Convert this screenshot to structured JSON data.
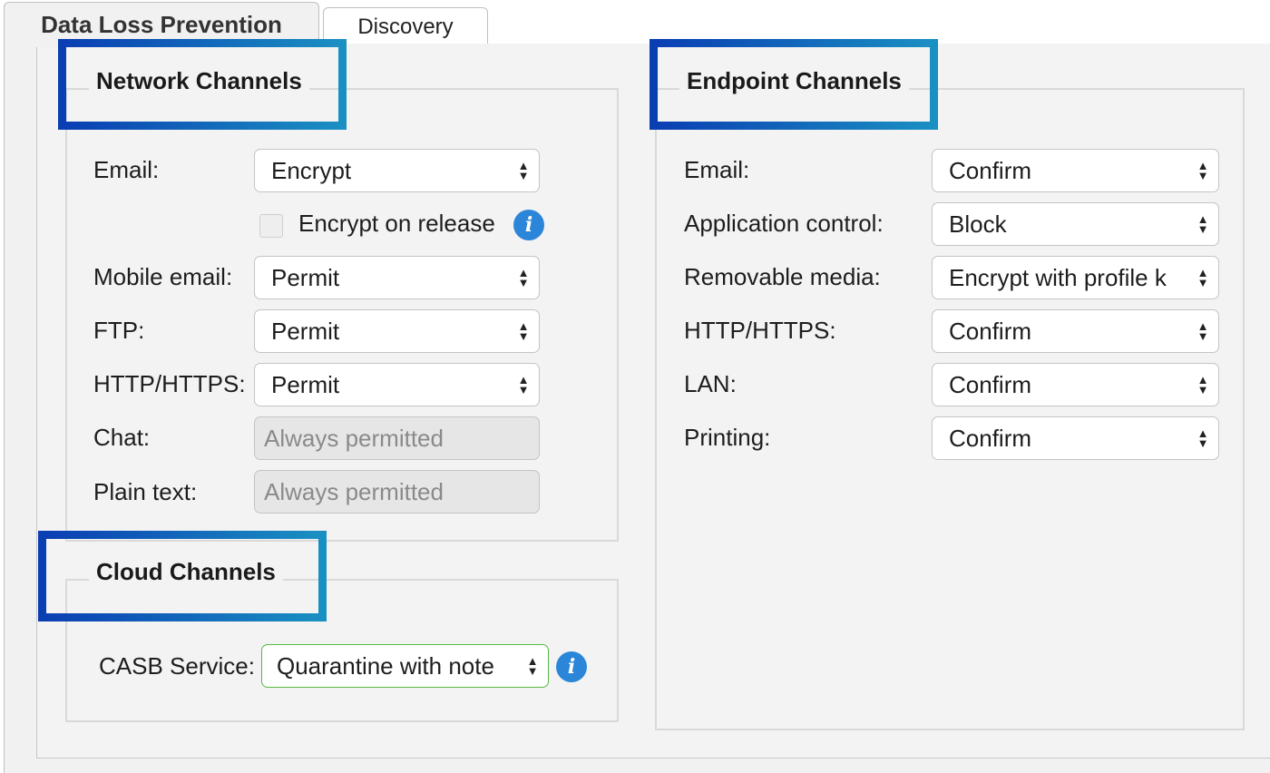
{
  "tabs": [
    {
      "label": "Data Loss Prevention",
      "active": true
    },
    {
      "label": "Discovery",
      "active": false
    }
  ],
  "network": {
    "title": "Network Channels",
    "email": {
      "label": "Email:",
      "value": "Encrypt"
    },
    "encrypt_on_release": {
      "label": "Encrypt on release",
      "checked": false
    },
    "mobile_email": {
      "label": "Mobile email:",
      "value": "Permit"
    },
    "ftp": {
      "label": "FTP:",
      "value": "Permit"
    },
    "http": {
      "label": "HTTP/HTTPS:",
      "value": "Permit"
    },
    "chat": {
      "label": "Chat:",
      "value": "Always permitted"
    },
    "plain_text": {
      "label": "Plain text:",
      "value": "Always permitted"
    }
  },
  "cloud": {
    "title": "Cloud Channels",
    "casb": {
      "label": "CASB Service:",
      "value": "Quarantine with note"
    }
  },
  "endpoint": {
    "title": "Endpoint Channels",
    "email": {
      "label": "Email:",
      "value": "Confirm"
    },
    "app_control": {
      "label": "Application control:",
      "value": "Block"
    },
    "removable_media": {
      "label": "Removable media:",
      "value": "Encrypt with profile k"
    },
    "http": {
      "label": "HTTP/HTTPS:",
      "value": "Confirm"
    },
    "lan": {
      "label": "LAN:",
      "value": "Confirm"
    },
    "printing": {
      "label": "Printing:",
      "value": "Confirm"
    }
  },
  "icons": {
    "info": "i",
    "select_arrows_up": "▲",
    "select_arrows_down": "▼"
  },
  "colors": {
    "highlight": "#0c47b7",
    "info": "#2b86d9",
    "focus": "#57b846"
  }
}
